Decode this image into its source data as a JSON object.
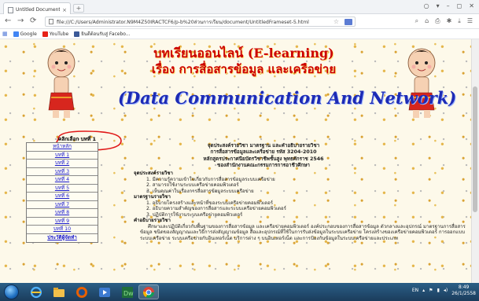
{
  "browser": {
    "tab_title": "Untitled Document",
    "tab_close": "×",
    "new_tab": "+",
    "url": "file:///C:/Users/Administrator.N9M4Z50IRACTCF6/p-b%20ส่วนการเรียน/document/UntitledFrameset-5.html",
    "window_controls": [
      "○",
      "▾",
      "–",
      "◻",
      "✕"
    ],
    "bookmarks": [
      {
        "label": "Google",
        "color": "#4285f4"
      },
      {
        "label": "YouTube",
        "color": "#e62117"
      },
      {
        "label": "ยินดีต้อนรับสู่ Facebo...",
        "color": "#3b5998"
      }
    ]
  },
  "page": {
    "title_line1": "บทเรียนออนไลน์ (E-learning)",
    "title_line2": "เรื่อง การสื่อสารข้อมูล และเครือข่าย",
    "title_line3": "(Data Communication And Network)",
    "callout": "คลิกเลือก บทที่ 1",
    "menu": [
      "หน้าหลัก",
      "บทที่ 1",
      "บทที่ 2",
      "บทที่ 3",
      "บทที่ 4",
      "บทที่ 5",
      "บทที่ 6",
      "บทที่ 7",
      "บทที่ 8",
      "บทที่ 9",
      "บทที่ 10",
      "ประวัติผู้จัดทำ"
    ],
    "info_lines": [
      "จุดประสงค์รายวิชา มาตรฐาน และคำอธิบายรายวิชา",
      "การสื่อสารข้อมูลและเครือข่าย รหัส 3204-2010",
      "หลักสูตรประกาศนียบัตรวิชาชีพชั้นสูง พุทธศักราช 2546",
      "ของสำนักงานคณะกรรมการการอาชีวศึกษา"
    ],
    "sections": [
      {
        "heading": "จุดประสงค์รายวิชา",
        "items": [
          "1. มีความรู้ความเข้าใจเกี่ยวกับการสื่อสารข้อมูลระบบเครือข่าย",
          "2. สามารถใช้งานระบบเครือข่ายคอมพิวเตอร์",
          "3. เห็นคุณค่าในเรื่องการสื่อสารข้อมูลระบบเครือข่าย"
        ]
      },
      {
        "heading": "มาตรฐานรายวิชา",
        "items": [
          "1. อธิบายโครงสร้างและหน้าที่ของระบบเครือข่ายคอมพิวเตอร์",
          "2. อธิบายความสำคัญของการสื่อสารและระบบเครือข่ายคอมพิวเตอร์",
          "3. ปฏิบัติการใช้งานระบบเครือข่ายคอมพิวเตอร์"
        ]
      },
      {
        "heading": "คำอธิบายรายวิชา",
        "paragraph": "ศึกษาและปฏิบัติเกี่ยวกับพื้นฐานของการสื่อสารข้อมูล และเครือข่ายคอมพิวเตอร์ องค์ประกอบของการสื่อสารข้อมูล ตัวกลางและอุปกรณ์ มาตรฐานการสื่อสารข้อมูล ชนิดของสัญญาณและวิธีการส่งสัญญาณข้อมูล สื่อและอุปกรณ์ที่ใช้ในการรับส่งข้อมูลในระบบเครือข่าย โครงสร้างของเครือข่ายคอมพิวเตอร์ การออกแบบ ระบบเครือข่าย ระบบเครือข่ายกับอินเทอร์เน็ต บริการต่าง ๆ บนอินเทอร์เน็ต และการป้องกันข้อมูลในระบบเครือข่ายและประเภท"
      }
    ]
  },
  "taskbar": {
    "apps": [
      "ie-icon",
      "explorer-icon",
      "firefox-icon",
      "media-icon",
      "dreamweaver-icon",
      "chrome-icon"
    ],
    "lang": "EN",
    "time": "8:49",
    "date": "26/1/2558"
  },
  "colors": {
    "title_red": "#cc0000",
    "title_blue": "#1d2bb5",
    "link_blue": "#1a1acc",
    "callout_red": "#e01818"
  }
}
